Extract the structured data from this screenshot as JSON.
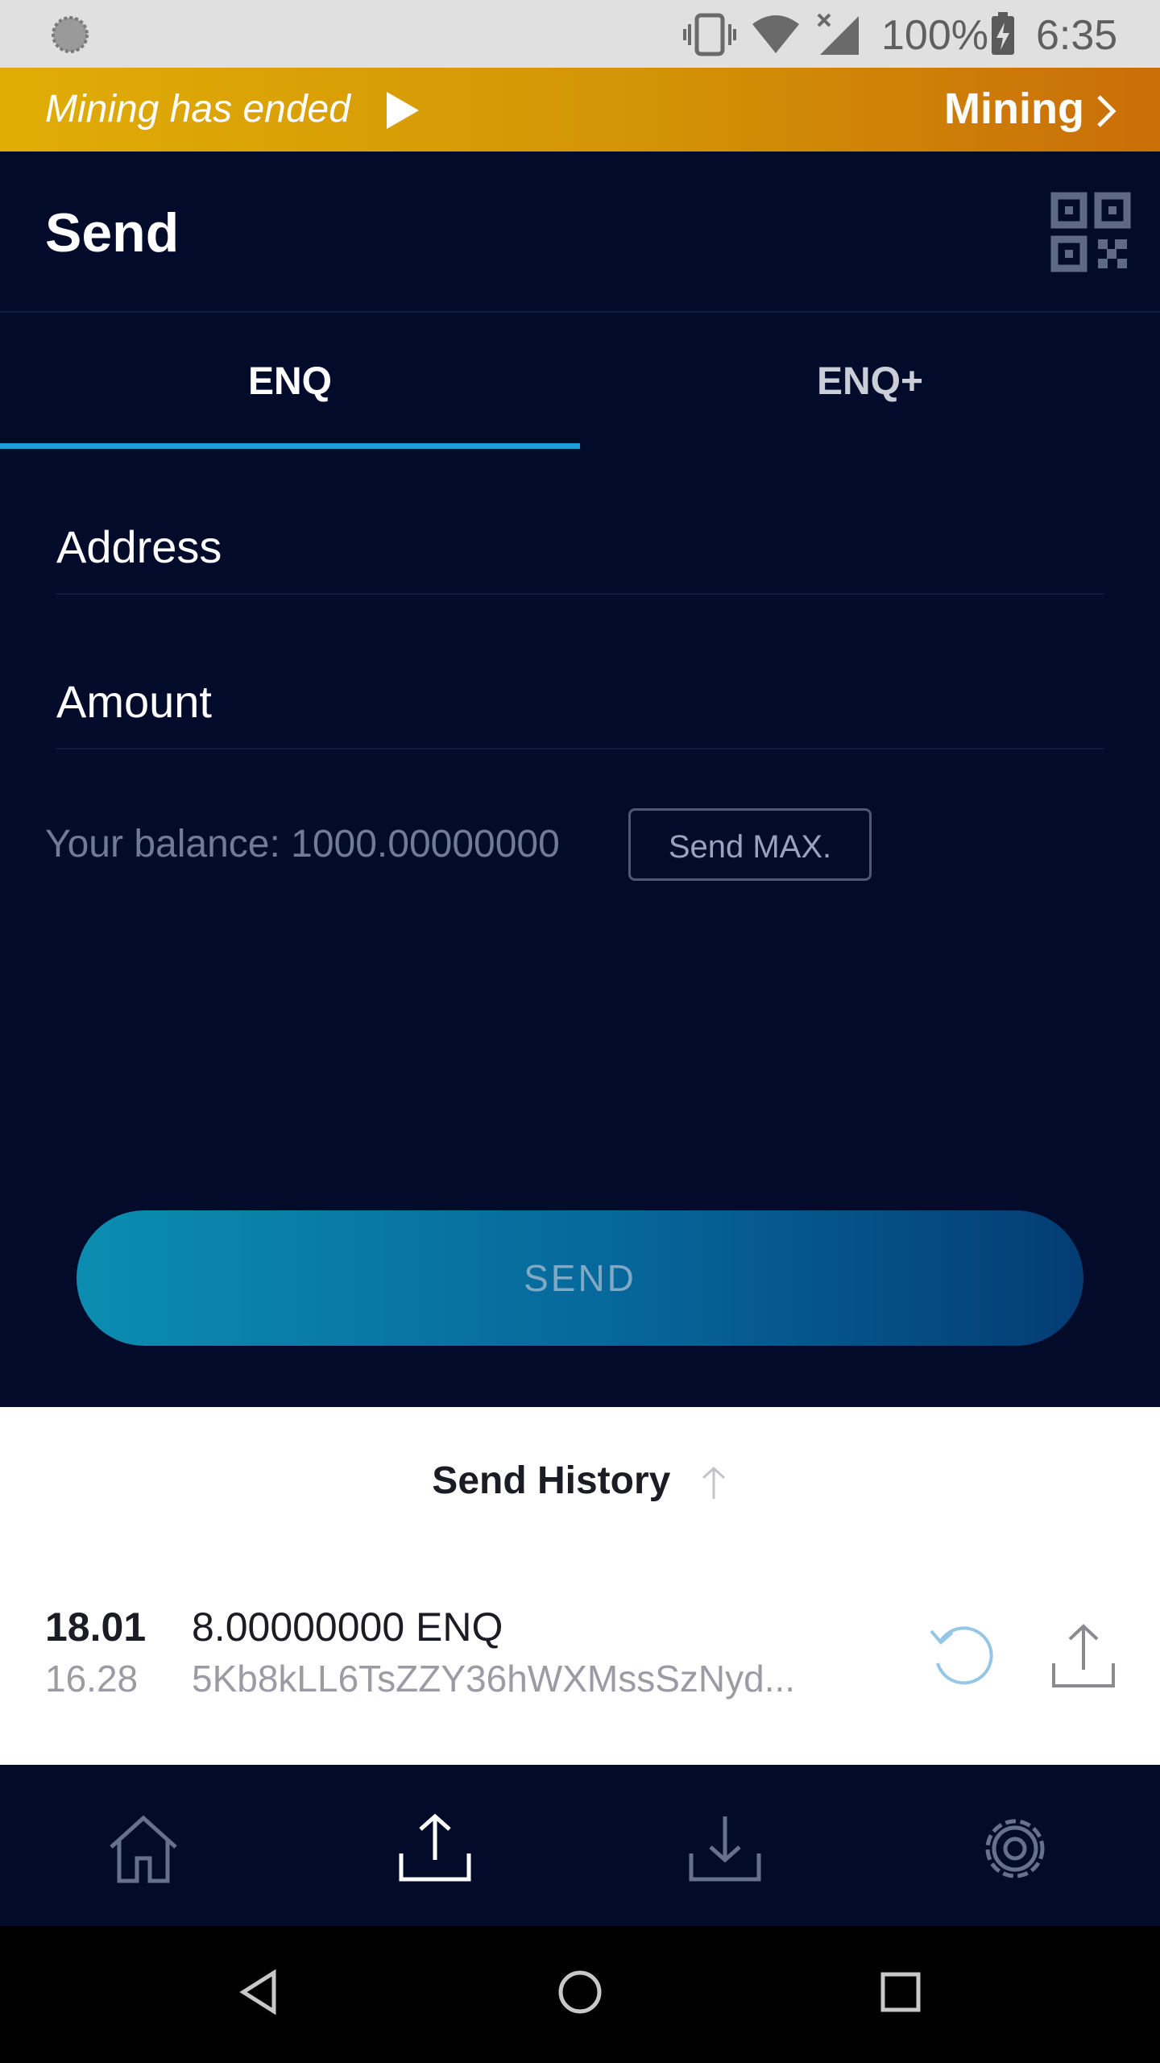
{
  "status_bar": {
    "battery": "100%",
    "time": "6:35"
  },
  "banner": {
    "ended_text": "Mining has ended",
    "mining_label": "Mining"
  },
  "header": {
    "title": "Send"
  },
  "tabs": [
    {
      "label": "ENQ",
      "active": true
    },
    {
      "label": "ENQ+",
      "active": false
    }
  ],
  "form": {
    "address_placeholder": "Address",
    "amount_placeholder": "Amount",
    "balance_text": "Your balance: 1000.00000000",
    "send_max_label": "Send MAX.",
    "send_label": "SEND"
  },
  "history": {
    "title": "Send History",
    "items": [
      {
        "date": "18.01",
        "time": "16.28",
        "amount": "8.00000000 ENQ",
        "address": "5Kb8kLL6TsZZY36hWXMssSzNyd..."
      }
    ]
  },
  "colors": {
    "background": "#020b2a",
    "accent": "#1e9fd9",
    "banner_start": "#e0ad06",
    "banner_end": "#c96e08"
  }
}
